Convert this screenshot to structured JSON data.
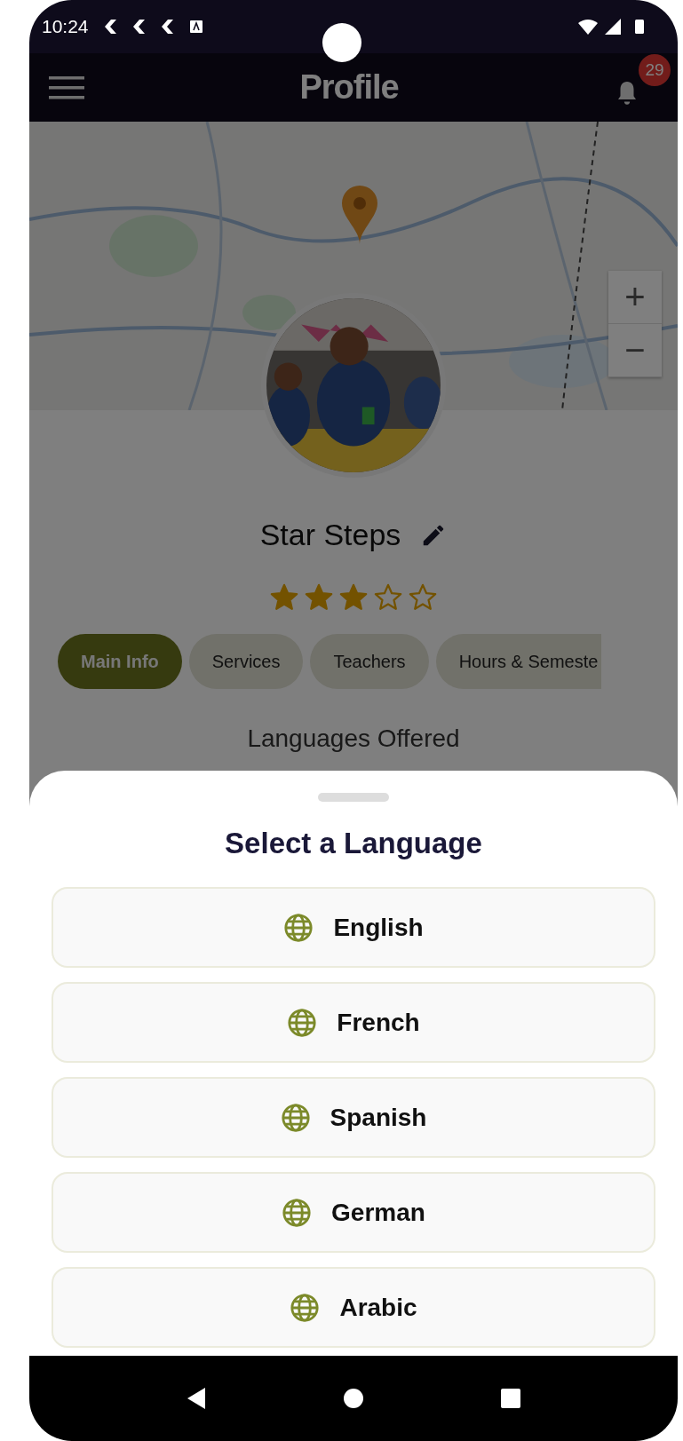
{
  "status_bar": {
    "time": "10:24"
  },
  "app_bar": {
    "title": "Profile",
    "notification_count": "29"
  },
  "map": {
    "kind": "picture",
    "zoom_in": "+",
    "zoom_out": "−"
  },
  "profile": {
    "name": "Star Steps",
    "stars": 3
  },
  "tabs": [
    {
      "label": "Main Info",
      "selected": true
    },
    {
      "label": "Services",
      "selected": false
    },
    {
      "label": "Teachers",
      "selected": false
    },
    {
      "label": "Hours & Semeste",
      "selected": false
    }
  ],
  "section_title": "Languages Offered",
  "language_sheet": {
    "title": "Select a Language",
    "languages": [
      {
        "label": "English"
      },
      {
        "label": "French"
      },
      {
        "label": "Spanish"
      },
      {
        "label": "German"
      },
      {
        "label": "Arabic"
      }
    ]
  }
}
